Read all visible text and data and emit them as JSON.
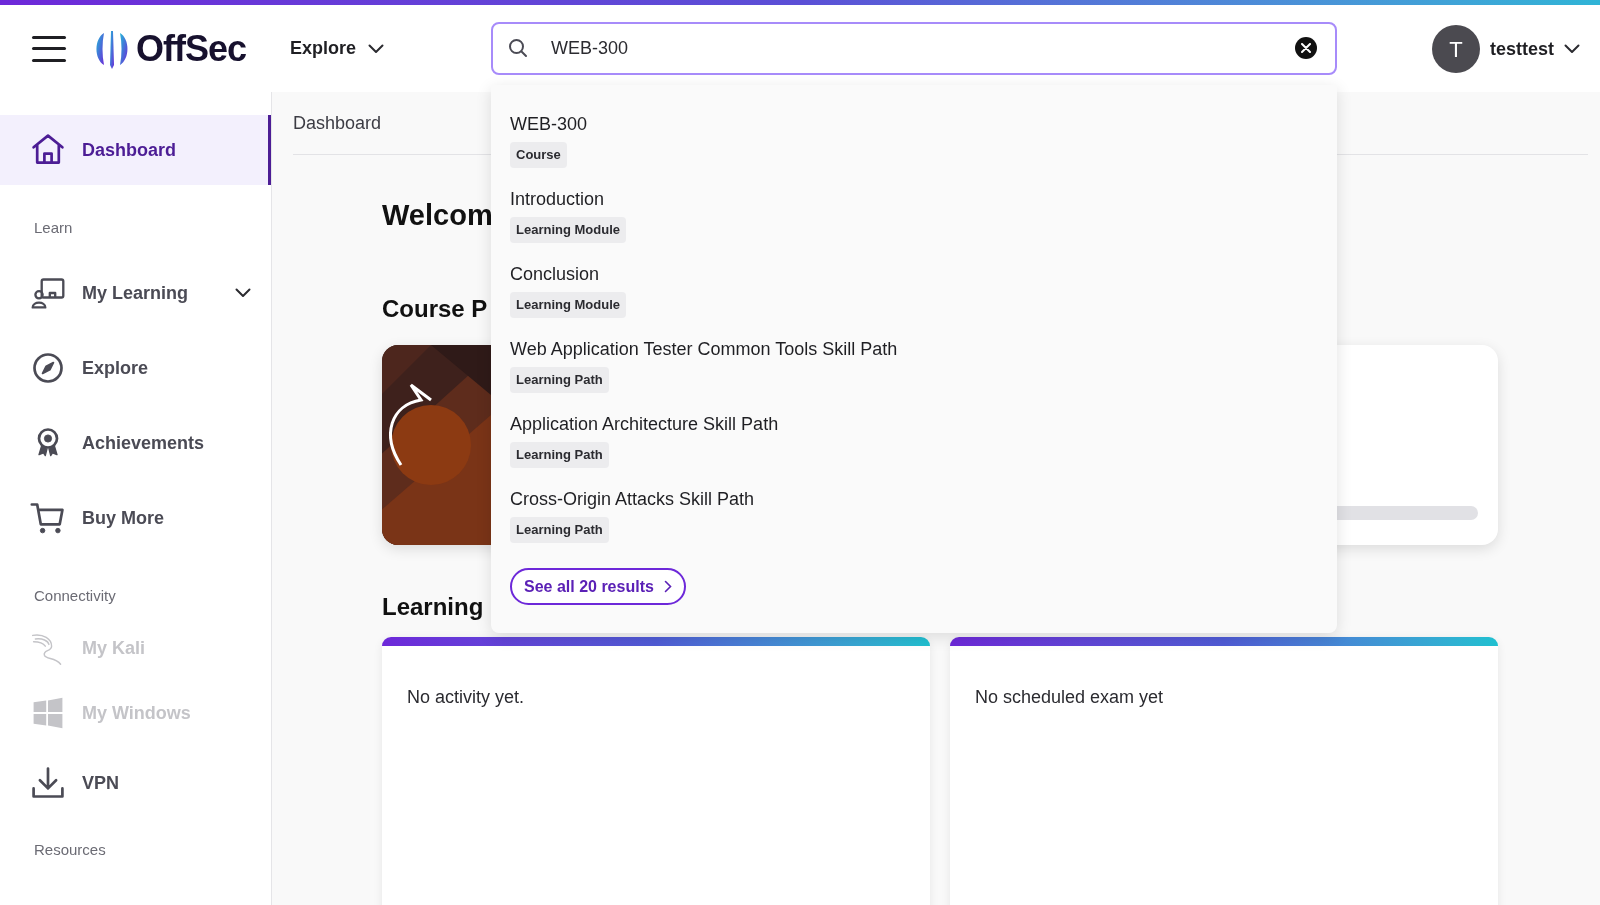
{
  "header": {
    "logo": "OffSec",
    "explore_menu": {
      "label": "Explore",
      "expanded": false
    },
    "search": {
      "value": "WEB-300"
    },
    "user": {
      "initial": "T",
      "name": "testtest"
    }
  },
  "sidebar": {
    "sections": [
      {
        "items": [
          {
            "label": "Dashboard",
            "selected": true,
            "disabled": false
          }
        ]
      },
      {
        "title": "Learn",
        "items": [
          {
            "label": "My Learning",
            "selected": false,
            "disabled": false,
            "kind": "expandable",
            "expanded": false
          },
          {
            "label": "Explore",
            "selected": false,
            "disabled": false
          },
          {
            "label": "Achievements",
            "selected": false,
            "disabled": false
          },
          {
            "label": "Buy More",
            "selected": false,
            "disabled": false
          }
        ]
      },
      {
        "title": "Connectivity",
        "items": [
          {
            "label": "My Kali",
            "selected": false,
            "disabled": true
          },
          {
            "label": "My Windows",
            "selected": false,
            "disabled": true
          },
          {
            "label": "VPN",
            "selected": false,
            "disabled": false
          }
        ]
      },
      {
        "title": "Resources"
      }
    ]
  },
  "breadcrumb": "Dashboard",
  "main": {
    "welcome_heading": "Welcom",
    "course_heading": "Course P",
    "learning_heading": "Learning",
    "activity_card": {
      "text": "No activity yet."
    },
    "exam_card": {
      "text": "No scheduled exam yet"
    }
  },
  "search_results": {
    "items": [
      {
        "title": "WEB-300",
        "type": "Course"
      },
      {
        "title": "Introduction",
        "type": "Learning Module"
      },
      {
        "title": "Conclusion",
        "type": "Learning Module"
      },
      {
        "title": "Web Application Tester Common Tools Skill Path",
        "type": "Learning Path"
      },
      {
        "title": "Application Architecture Skill Path",
        "type": "Learning Path"
      },
      {
        "title": "Cross-Origin Attacks Skill Path",
        "type": "Learning Path"
      }
    ],
    "see_all": "See all 20 results"
  }
}
